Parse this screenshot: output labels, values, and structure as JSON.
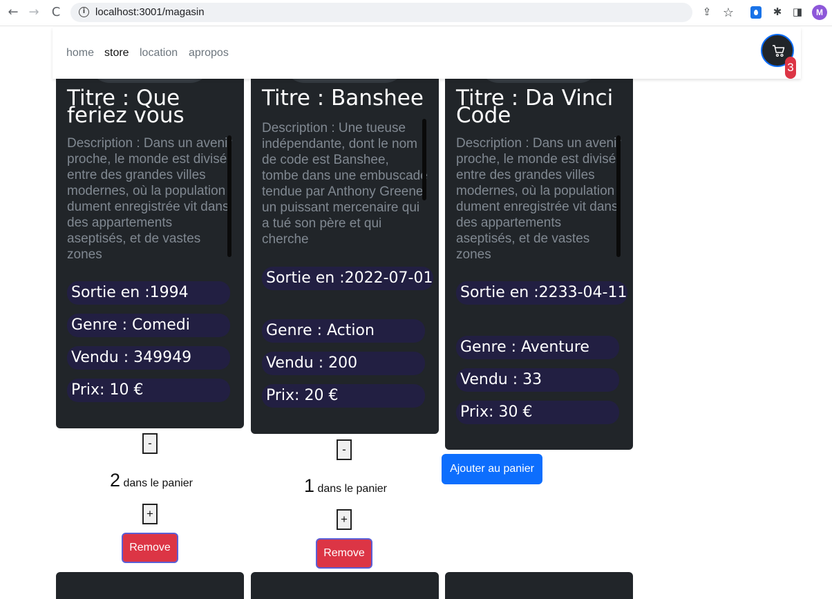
{
  "browser": {
    "url": "localhost:3001/magasin",
    "back_glyph": "←",
    "forward_glyph": "→",
    "reload_glyph": "C",
    "info_glyph": "i",
    "share_glyph": "⇪",
    "star_glyph": "☆",
    "puzzle_glyph": "✱",
    "sidepanel_glyph": "◨",
    "profile_initial": "M"
  },
  "nav": {
    "links": [
      "home",
      "store",
      "location",
      "apropos"
    ],
    "active": "store",
    "cart_count": "3"
  },
  "cards": [
    {
      "title": "Titre : Que feriez vous",
      "description": "Description : Dans un avenir proche, le monde est divisé entre des grandes villes modernes, où la population dument enregistrée vit dans des appartements aseptisés, et de vastes zones",
      "sortie": "Sortie en :1994",
      "genre": "Genre : Comedi",
      "vendu": "Vendu : 349949",
      "prix": "Prix: 10 €",
      "in_cart": true,
      "minus_label": "-",
      "plus_label": "+",
      "quantity": "2",
      "quantity_text": " dans le panier",
      "remove_label": "Remove"
    },
    {
      "title": "Titre : Banshee",
      "description": "Description : Une tueuse indépendante, dont le nom de code est Banshee, tombe dans une embuscade tendue par Anthony Greene, un puissant mercenaire qui a tué son père et qui cherche",
      "sortie": "Sortie en :2022-07-01",
      "genre": "Genre : Action",
      "vendu": "Vendu : 200",
      "prix": "Prix: 20 €",
      "in_cart": true,
      "minus_label": "-",
      "plus_label": "+",
      "quantity": "1",
      "quantity_text": " dans le panier",
      "remove_label": "Remove"
    },
    {
      "title": "Titre : Da Vinci Code",
      "description": "Description : Dans un avenir proche, le monde est divisé entre des grandes villes modernes, où la population dument enregistrée vit dans des appartements aseptisés, et de vastes zones",
      "sortie": "Sortie en :2233-04-11",
      "genre": "Genre : Aventure",
      "vendu": "Vendu : 33",
      "prix": "Prix: 30 €",
      "in_cart": false,
      "add_label": "Ajouter au panier"
    }
  ]
}
